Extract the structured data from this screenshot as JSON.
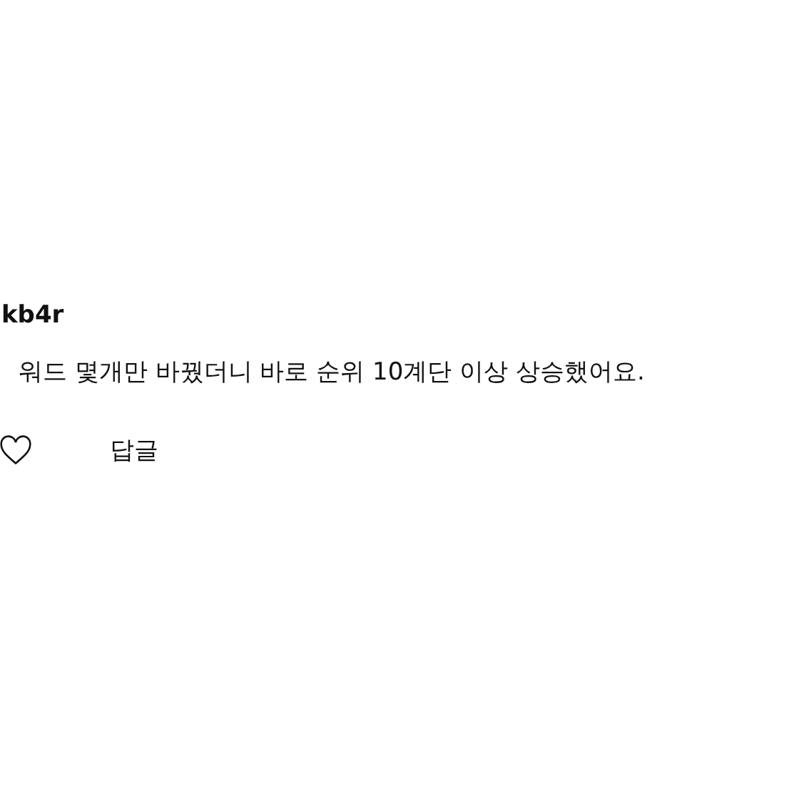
{
  "comment": {
    "username": "kb4r",
    "text": "워드 몇개만 바꿨더니 바로 순위 10계단 이상 상승했어요.",
    "liked": false,
    "reply_label": "답글"
  }
}
